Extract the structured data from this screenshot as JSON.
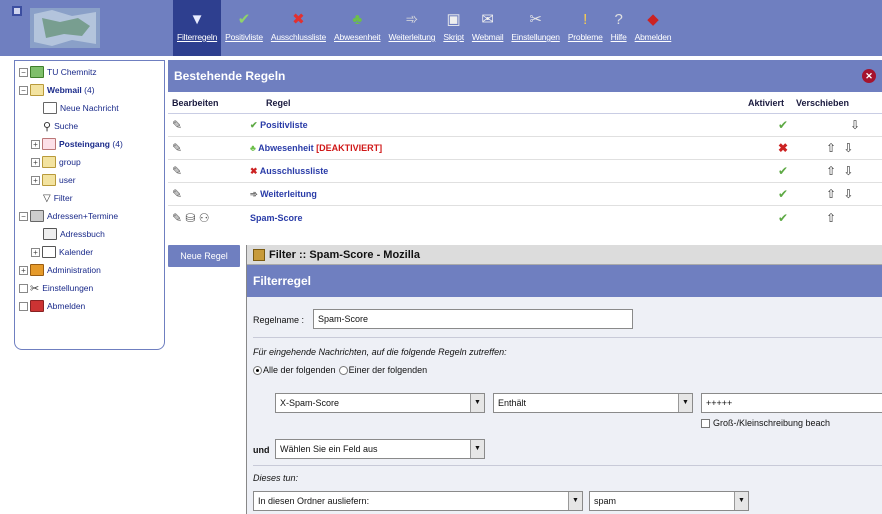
{
  "toolbar": {
    "items": [
      {
        "label": "Filterregeln",
        "icon": "filter-icon",
        "active": true
      },
      {
        "label": "Positivliste",
        "icon": "check-icon"
      },
      {
        "label": "Ausschlussliste",
        "icon": "x-icon"
      },
      {
        "label": "Abwesenheit",
        "icon": "palm-icon"
      },
      {
        "label": "Weiterleitung",
        "icon": "forward-icon"
      },
      {
        "label": "Skript",
        "icon": "script-icon"
      },
      {
        "label": "Webmail",
        "icon": "mail-icon"
      },
      {
        "label": "Einstellungen",
        "icon": "tools-icon"
      },
      {
        "label": "Probleme",
        "icon": "warning-icon"
      },
      {
        "label": "Hilfe",
        "icon": "help-icon"
      },
      {
        "label": "Abmelden",
        "icon": "logout-icon"
      }
    ]
  },
  "tree": {
    "root": "TU Chemnitz",
    "webmail": "Webmail",
    "webmail_count": "(4)",
    "neue_nachricht": "Neue Nachricht",
    "suche": "Suche",
    "posteingang": "Posteingang",
    "posteingang_count": "(4)",
    "group": "group",
    "user": "user",
    "filter": "Filter",
    "adressen": "Adressen+Termine",
    "adressbuch": "Adressbuch",
    "kalender": "Kalender",
    "administration": "Administration",
    "einstellungen": "Einstellungen",
    "abmelden": "Abmelden"
  },
  "rules": {
    "title": "Bestehende Regeln",
    "col_edit": "Bearbeiten",
    "col_rule": "Regel",
    "col_active": "Aktiviert",
    "col_move": "Verschieben",
    "rows": [
      {
        "name": "Positivliste",
        "suffix": "",
        "active": true,
        "move": "⇩"
      },
      {
        "name": "Abwesenheit",
        "suffix": "[DEAKTIVIERT]",
        "active": false,
        "move": "⇧ ⇩"
      },
      {
        "name": "Ausschlussliste",
        "suffix": "",
        "active": true,
        "move": "⇧ ⇩"
      },
      {
        "name": "Weiterleitung",
        "suffix": "",
        "active": true,
        "move": "⇧ ⇩"
      },
      {
        "name": "Spam-Score",
        "suffix": "",
        "active": true,
        "move": "⇧"
      }
    ]
  },
  "new_rule_button": "Neue Regel",
  "popup": {
    "window_title": "Filter :: Spam-Score - Mozilla",
    "header": "Filterregel",
    "regelname_label": "Regelname :",
    "regelname_value": "Spam-Score",
    "intro": "Für eingehende Nachrichten, auf die folgende Regeln zutreffen:",
    "radio_all": "Alle der folgenden",
    "radio_any": "Einer der folgenden",
    "cond_field": "X-Spam-Score",
    "cond_op": "Enthält",
    "cond_value": "+++++",
    "case_label": "Groß-/Kleinschreibung beach",
    "und": "und",
    "field2": "Wählen Sie ein Feld aus",
    "action_label": "Dieses tun:",
    "action": "In diesen Ordner ausliefern:",
    "folder": "spam"
  }
}
